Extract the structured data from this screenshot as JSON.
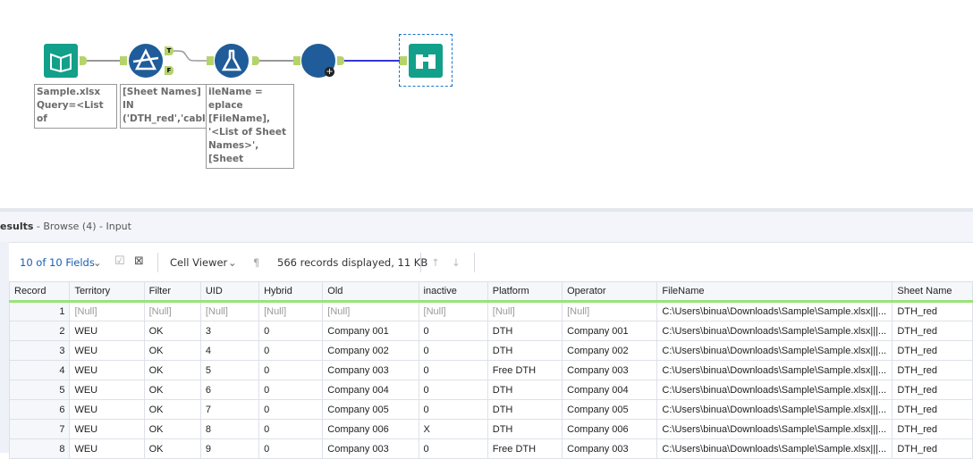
{
  "workflow": {
    "annotations": [
      "Sample.xlsx\nQuery=<List of\nSheet Names>",
      "[Sheet Names] IN\n('DTH_red','cable_\nred','Boop_red')",
      "ileName =\neplace\n[FileName],\n'<List of Sheet\nNames>', [Sheet\nNames])"
    ],
    "filter_true": "T",
    "filter_false": "F"
  },
  "results": {
    "title": "esults",
    "subtitle": " - Browse (4) - Input"
  },
  "toolbar": {
    "fields": "10 of 10 Fields",
    "viewer": "Cell Viewer",
    "status": "566 records displayed, 11 KB"
  },
  "table": {
    "columns": [
      "Record",
      "Territory",
      "Filter",
      "UID",
      "Hybrid",
      "Old",
      "inactive",
      "Platform",
      "Operator",
      "FileName",
      "Sheet Name"
    ],
    "rows": [
      [
        "1",
        "[Null]",
        "[Null]",
        "[Null]",
        "[Null]",
        "[Null]",
        "[Null]",
        "[Null]",
        "[Null]",
        "C:\\Users\\binua\\Downloads\\Sample\\Sample.xlsx|||...",
        "DTH_red"
      ],
      [
        "2",
        "WEU",
        "OK",
        "3",
        "0",
        "Company 001",
        "0",
        "DTH",
        "Company 001",
        "C:\\Users\\binua\\Downloads\\Sample\\Sample.xlsx|||...",
        "DTH_red"
      ],
      [
        "3",
        "WEU",
        "OK",
        "4",
        "0",
        "Company 002",
        "0",
        "DTH",
        "Company 002",
        "C:\\Users\\binua\\Downloads\\Sample\\Sample.xlsx|||...",
        "DTH_red"
      ],
      [
        "4",
        "WEU",
        "OK",
        "5",
        "0",
        "Company 003",
        "0",
        "Free DTH",
        "Company 003",
        "C:\\Users\\binua\\Downloads\\Sample\\Sample.xlsx|||...",
        "DTH_red"
      ],
      [
        "5",
        "WEU",
        "OK",
        "6",
        "0",
        "Company 004",
        "0",
        "DTH",
        "Company 004",
        "C:\\Users\\binua\\Downloads\\Sample\\Sample.xlsx|||...",
        "DTH_red"
      ],
      [
        "6",
        "WEU",
        "OK",
        "7",
        "0",
        "Company 005",
        "0",
        "DTH",
        "Company 005",
        "C:\\Users\\binua\\Downloads\\Sample\\Sample.xlsx|||...",
        "DTH_red"
      ],
      [
        "7",
        "WEU",
        "OK",
        "8",
        "0",
        "Company 006",
        "X",
        "DTH",
        "Company 006",
        "C:\\Users\\binua\\Downloads\\Sample\\Sample.xlsx|||...",
        "DTH_red"
      ],
      [
        "8",
        "WEU",
        "OK",
        "9",
        "0",
        "Company 003",
        "0",
        "Free DTH",
        "Company 003",
        "C:\\Users\\binua\\Downloads\\Sample\\Sample.xlsx|||...",
        "DTH_red"
      ]
    ]
  },
  "colors": {
    "teal": "#12a08a",
    "blue": "#1f5c99",
    "anchor": "#b5d36b",
    "link": "#1a5fb4"
  }
}
